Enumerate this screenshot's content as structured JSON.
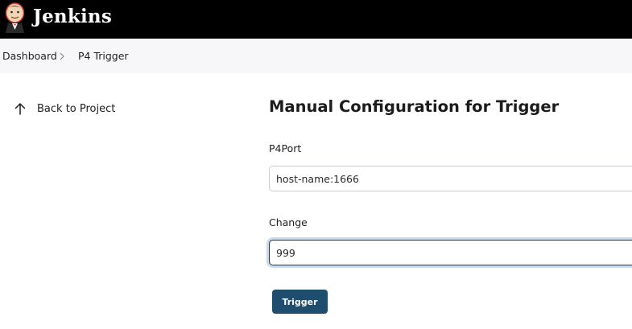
{
  "header": {
    "brand": "Jenkins",
    "logo_icon": "jenkins-butler-logo"
  },
  "breadcrumb": {
    "items": [
      "Dashboard",
      "P4 Trigger"
    ],
    "separator_icon": "chevron-right-icon"
  },
  "sidebar": {
    "back_label": "Back to Project",
    "back_icon": "arrow-up-icon"
  },
  "main": {
    "title": "Manual Configuration for Trigger",
    "fields": [
      {
        "label": "P4Port",
        "value": "host-name:1666"
      },
      {
        "label": "Change",
        "value": "999"
      }
    ],
    "submit_label": "Trigger"
  },
  "colors": {
    "header_bg": "#000000",
    "breadcrumb_bg": "#f7f7f9",
    "button_bg": "#1e4d6e",
    "focus_ring": "#c9dcef"
  }
}
